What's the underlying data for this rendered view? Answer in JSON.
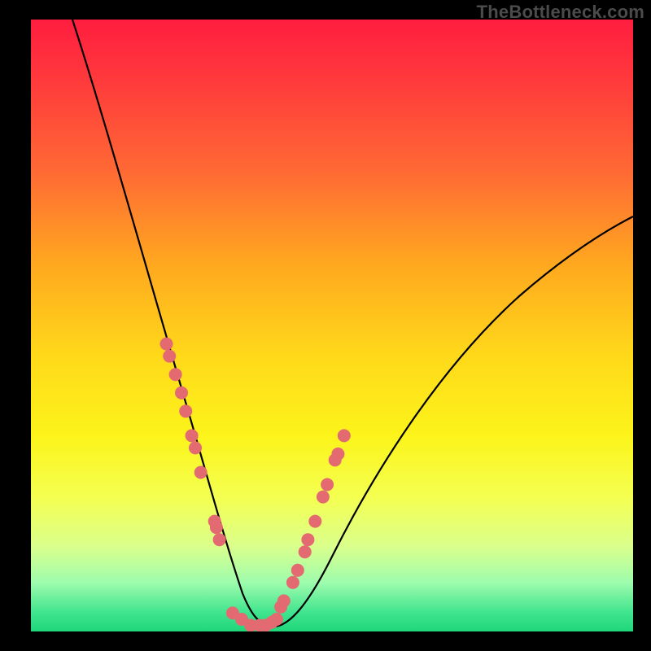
{
  "watermark": {
    "text": "TheBottleneck.com"
  },
  "chart_data": {
    "type": "line",
    "title": "",
    "xlabel": "",
    "ylabel": "",
    "xlim": [
      0,
      100
    ],
    "ylim": [
      0,
      100
    ],
    "grid": false,
    "legend": false,
    "series": [
      {
        "name": "bottleneck-curve",
        "x": [
          7,
          10,
          13,
          16,
          19,
          22,
          24,
          26,
          28,
          30,
          31.5,
          33,
          34.5,
          36,
          37,
          38,
          40,
          43,
          47,
          52,
          58,
          65,
          73,
          82,
          92,
          100
        ],
        "y": [
          100,
          90,
          80,
          70,
          60,
          50,
          43,
          36,
          29,
          22,
          16,
          11,
          7,
          4,
          2,
          1,
          1,
          3,
          8,
          16,
          25,
          34,
          43,
          51,
          58,
          63
        ]
      }
    ],
    "markers": [
      {
        "name": "dots-left-descent",
        "color": "#e46a72",
        "x": [
          22.5,
          23.0,
          24.0,
          25.0,
          25.7,
          26.7,
          27.3,
          28.2,
          30.5,
          30.8,
          31.3
        ],
        "y": [
          47,
          45,
          42,
          39,
          36,
          32,
          30,
          26,
          18,
          17,
          15
        ]
      },
      {
        "name": "dots-valley-floor",
        "color": "#e46a72",
        "x": [
          33.5,
          35.0,
          36.5,
          38.0,
          39.0,
          40.0,
          40.8
        ],
        "y": [
          3,
          2,
          1,
          1,
          1,
          1.5,
          2
        ]
      },
      {
        "name": "dots-right-ascent",
        "color": "#e46a72",
        "x": [
          41.5,
          42.0,
          43.5,
          44.3,
          45.5,
          46.0,
          47.2,
          48.5,
          49.2,
          50.5,
          51.0,
          52.0
        ],
        "y": [
          4,
          5,
          8,
          10,
          13,
          15,
          18,
          22,
          24,
          28,
          29,
          32
        ]
      }
    ],
    "annotations": []
  }
}
